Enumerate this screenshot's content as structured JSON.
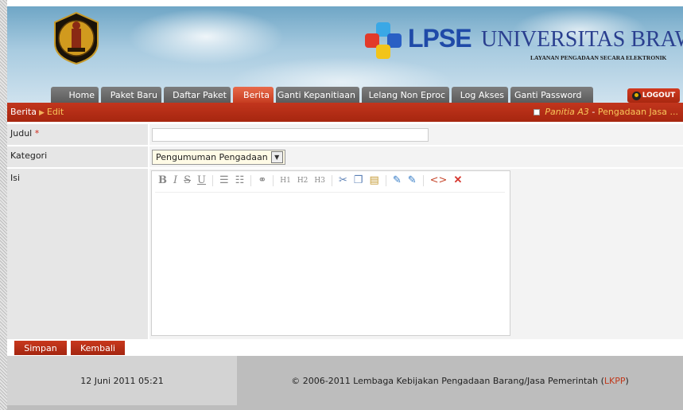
{
  "header": {
    "brand_name": "LPSE",
    "brand_university": "UNIVERSITAS BRAWIJAYA",
    "brand_subtitle": "LAYANAN PENGADAAN SECARA ELEKTRONIK"
  },
  "nav": {
    "tabs": [
      {
        "label": "Home",
        "active": false
      },
      {
        "label": "Paket Baru",
        "active": false
      },
      {
        "label": "Daftar Paket",
        "active": false
      },
      {
        "label": "Berita",
        "active": true
      },
      {
        "label": "Ganti Kepanitiaan",
        "active": false
      },
      {
        "label": "Lelang Non Eproc",
        "active": false
      },
      {
        "label": "Log Akses",
        "active": false
      },
      {
        "label": "Ganti Password",
        "active": false
      }
    ],
    "logout_label": "LOGOUT"
  },
  "breadcrumb": {
    "section": "Berita",
    "separator": "▶",
    "current": "Edit"
  },
  "panitia": {
    "name": "Panitia A3",
    "dash": " - ",
    "desc": "Pengadaan Jasa ..."
  },
  "form": {
    "judul_label": "Judul",
    "required_mark": "*",
    "judul_value": "",
    "kategori_label": "Kategori",
    "kategori_value": "Pengumuman Pengadaan",
    "isi_label": "Isi",
    "isi_value": ""
  },
  "toolbar": {
    "bold": "B",
    "italic": "I",
    "strike": "S",
    "underline": "U",
    "h1": "H1",
    "h2": "H2",
    "h3": "H3"
  },
  "buttons": {
    "save_label": "Simpan",
    "back_label": "Kembali"
  },
  "footer": {
    "datetime": "12 Juni 2011 05:21",
    "copyright": "© 2006-2011 Lembaga Kebijakan Pengadaan Barang/Jasa Pemerintah (",
    "lkpp": "LKPP",
    "close_paren": ")"
  },
  "colors": {
    "accent_red": "#b52d16",
    "active_tab": "#d4492c",
    "brand_blue": "#1f4aa8"
  }
}
